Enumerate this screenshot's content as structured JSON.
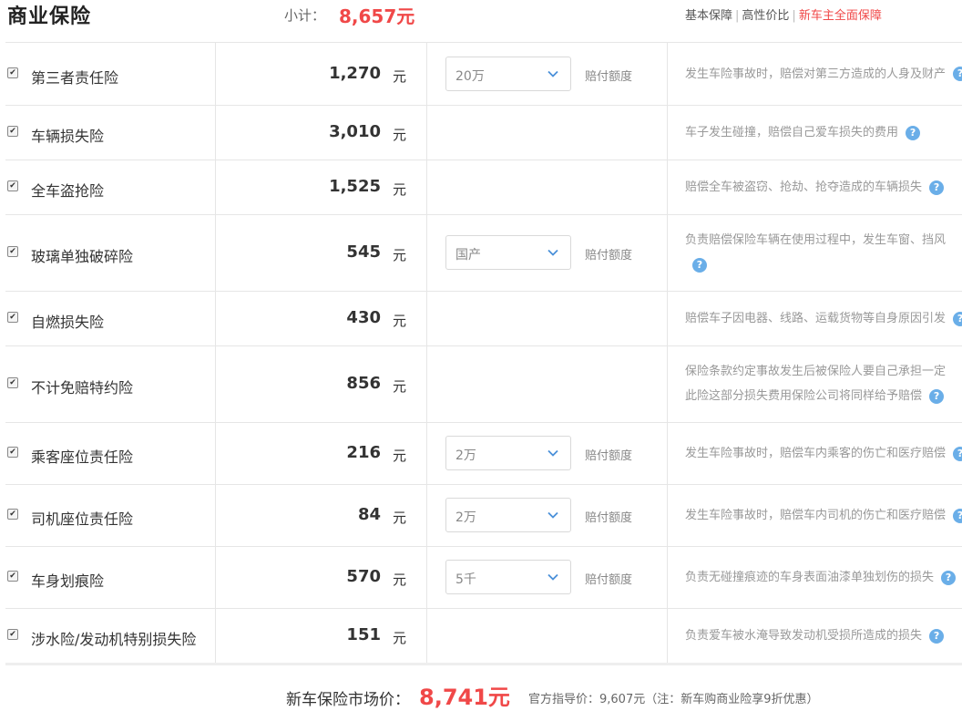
{
  "header": {
    "title": "商业保险",
    "subtotal_label": "小计：",
    "subtotal_value": "8,657元",
    "plans": [
      {
        "label": "基本保障",
        "active": false
      },
      {
        "label": "高性价比",
        "active": false
      },
      {
        "label": "新车主全面保障",
        "active": true
      }
    ]
  },
  "rows": [
    {
      "name": "第三者责任险",
      "price": "1,270",
      "unit": "元",
      "select": "20万",
      "amount_label": "赔付额度",
      "desc": [
        "发生车险事故时，赔偿对第三方造成的人身及财产"
      ],
      "checked": true
    },
    {
      "name": "车辆损失险",
      "price": "3,010",
      "unit": "元",
      "select": "",
      "amount_label": "",
      "desc": [
        "车子发生碰撞，赔偿自己爱车损失的费用"
      ],
      "checked": true
    },
    {
      "name": "全车盗抢险",
      "price": "1,525",
      "unit": "元",
      "select": "",
      "amount_label": "",
      "desc": [
        "赔偿全车被盗窃、抢劫、抢夺造成的车辆损失"
      ],
      "checked": true
    },
    {
      "name": "玻璃单独破碎险",
      "price": "545",
      "unit": "元",
      "select": "国产",
      "amount_label": "赔付额度",
      "desc": [
        "负责赔偿保险车辆在使用过程中，发生车窗、挡风",
        ""
      ],
      "checked": true
    },
    {
      "name": "自燃损失险",
      "price": "430",
      "unit": "元",
      "select": "",
      "amount_label": "",
      "desc": [
        "赔偿车子因电器、线路、运载货物等自身原因引发"
      ],
      "checked": true
    },
    {
      "name": "不计免赔特约险",
      "price": "856",
      "unit": "元",
      "select": "",
      "amount_label": "",
      "desc": [
        "保险条款约定事故发生后被保险人要自己承担一定",
        "此险这部分损失费用保险公司将同样给予赔偿"
      ],
      "checked": true
    },
    {
      "name": "乘客座位责任险",
      "price": "216",
      "unit": "元",
      "select": "2万",
      "amount_label": "赔付额度",
      "desc": [
        "发生车险事故时，赔偿车内乘客的伤亡和医疗赔偿"
      ],
      "checked": true
    },
    {
      "name": "司机座位责任险",
      "price": "84",
      "unit": "元",
      "select": "2万",
      "amount_label": "赔付额度",
      "desc": [
        "发生车险事故时，赔偿车内司机的伤亡和医疗赔偿"
      ],
      "checked": true
    },
    {
      "name": "车身划痕险",
      "price": "570",
      "unit": "元",
      "select": "5千",
      "amount_label": "赔付额度",
      "desc": [
        "负责无碰撞痕迹的车身表面油漆单独划伤的损失"
      ],
      "checked": true
    },
    {
      "name": "涉水险/发动机特别损失险",
      "price": "151",
      "unit": "元",
      "select": "",
      "amount_label": "",
      "desc": [
        "负责爱车被水淹导致发动机受损所造成的损失"
      ],
      "checked": true
    }
  ],
  "footer": {
    "market_label": "新车保险市场价：",
    "market_value": "8,741元",
    "official": "官方指导价：9,607元（注：新车购商业险享9折优惠）"
  },
  "colors": {
    "accent": "#f04848",
    "help_icon": "#6aaee8"
  },
  "icons": {
    "help": "question-icon",
    "dropdown": "chevron-down-icon",
    "checkbox": "checkbox-icon"
  }
}
